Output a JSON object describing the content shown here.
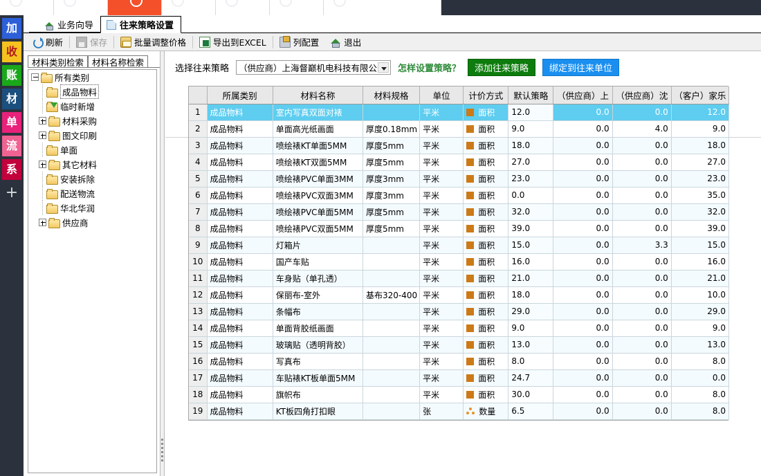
{
  "rail": {
    "items": [
      {
        "label": "加",
        "color": "#2d5fd9",
        "text": "#ffffff"
      },
      {
        "label": "收",
        "color": "#f5c21f",
        "text": "#b21b1b"
      },
      {
        "label": "账",
        "color": "#1aa81a",
        "text": "#ffffff"
      },
      {
        "label": "材",
        "color": "#1b4f7e",
        "text": "#ffffff"
      },
      {
        "label": "单",
        "color": "#e8217a",
        "text": "#ffffff"
      },
      {
        "label": "流",
        "color": "#f06292",
        "text": "#ffffff"
      },
      {
        "label": "系",
        "color": "#c2003c",
        "text": "#ffffff"
      }
    ],
    "add_label": "+"
  },
  "tabs": [
    {
      "label": "业务向导",
      "icon": "home-icon",
      "active": false
    },
    {
      "label": "往来策略设置",
      "icon": "document-icon",
      "active": true
    }
  ],
  "toolbar": {
    "refresh": "刷新",
    "save": "保存",
    "batch_price": "批量调整价格",
    "export_excel": "导出到EXCEL",
    "column_config": "列配置",
    "exit": "退出"
  },
  "left_panel": {
    "tabs": [
      {
        "label": "材料类别检索",
        "selected": true
      },
      {
        "label": "材料名称检索",
        "selected": false
      }
    ],
    "tree": [
      {
        "label": "所有类别",
        "depth": 0,
        "toggle": "minus",
        "folder": "open",
        "selected": false
      },
      {
        "label": "成品物料",
        "depth": 1,
        "toggle": "none",
        "folder": "closed",
        "selected": true
      },
      {
        "label": "临时新增",
        "depth": 1,
        "toggle": "none",
        "folder": "arrow",
        "selected": false
      },
      {
        "label": "材料采购",
        "depth": 1,
        "toggle": "plus",
        "folder": "closed",
        "selected": false
      },
      {
        "label": "图文印刷",
        "depth": 1,
        "toggle": "plus",
        "folder": "closed",
        "selected": false
      },
      {
        "label": "单面",
        "depth": 1,
        "toggle": "none",
        "folder": "closed",
        "selected": false
      },
      {
        "label": "其它材料",
        "depth": 1,
        "toggle": "plus",
        "folder": "closed",
        "selected": false
      },
      {
        "label": "安装拆除",
        "depth": 1,
        "toggle": "none",
        "folder": "closed",
        "selected": false
      },
      {
        "label": "配送物流",
        "depth": 1,
        "toggle": "none",
        "folder": "closed",
        "selected": false
      },
      {
        "label": "华北华润",
        "depth": 1,
        "toggle": "none",
        "folder": "closed",
        "selected": false
      },
      {
        "label": "供应商",
        "depth": 1,
        "toggle": "plus",
        "folder": "closed",
        "selected": false
      }
    ]
  },
  "control_bar": {
    "select_label": "选择往来策略",
    "combo_value": "（供应商）上海督巅机电科技有限公",
    "hint_link": "怎样设置策略？",
    "add_button": "添加往来策略",
    "bind_button": "绑定到往来单位",
    "add_button_color": "#0d7c0d",
    "bind_button_color": "#1a8ff0"
  },
  "grid": {
    "columns": [
      "",
      "所属类别",
      "材料名称",
      "材料规格",
      "单位",
      "计价方式",
      "默认策略",
      "（供应商）上",
      "（供应商）沈",
      "（客户）家乐"
    ],
    "rows": [
      {
        "idx": "1",
        "category": "成品物料",
        "name": "室内写真双面对裱",
        "spec": "",
        "unit": "平米",
        "price_mode": "面积",
        "mode_icon": "area-icon",
        "default": "12.0",
        "s1": "0.0",
        "s2": "0.0",
        "c1": "12.0",
        "selected": true
      },
      {
        "idx": "2",
        "category": "成品物料",
        "name": "单面高光纸画面",
        "spec": "厚度0.18mm",
        "unit": "平米",
        "price_mode": "面积",
        "mode_icon": "area-icon",
        "default": "9.0",
        "s1": "0.0",
        "s2": "4.0",
        "c1": "9.0",
        "selected": false
      },
      {
        "idx": "3",
        "category": "成品物料",
        "name": "喷绘裱KT单面5MM",
        "spec": "厚度5mm",
        "unit": "平米",
        "price_mode": "面积",
        "mode_icon": "area-icon",
        "default": "18.0",
        "s1": "0.0",
        "s2": "0.0",
        "c1": "18.0",
        "selected": false
      },
      {
        "idx": "4",
        "category": "成品物料",
        "name": "喷绘裱KT双面5MM",
        "spec": "厚度5mm",
        "unit": "平米",
        "price_mode": "面积",
        "mode_icon": "area-icon",
        "default": "27.0",
        "s1": "0.0",
        "s2": "0.0",
        "c1": "27.0",
        "selected": false
      },
      {
        "idx": "5",
        "category": "成品物料",
        "name": "喷绘裱PVC单面3MM",
        "spec": "厚度3mm",
        "unit": "平米",
        "price_mode": "面积",
        "mode_icon": "area-icon",
        "default": "23.0",
        "s1": "0.0",
        "s2": "0.0",
        "c1": "23.0",
        "selected": false
      },
      {
        "idx": "6",
        "category": "成品物料",
        "name": "喷绘裱PVC双面3MM",
        "spec": "厚度3mm",
        "unit": "平米",
        "price_mode": "面积",
        "mode_icon": "area-icon",
        "default": "0.0",
        "s1": "0.0",
        "s2": "0.0",
        "c1": "35.0",
        "selected": false
      },
      {
        "idx": "7",
        "category": "成品物料",
        "name": "喷绘裱PVC单面5MM",
        "spec": "厚度5mm",
        "unit": "平米",
        "price_mode": "面积",
        "mode_icon": "area-icon",
        "default": "32.0",
        "s1": "0.0",
        "s2": "0.0",
        "c1": "32.0",
        "selected": false
      },
      {
        "idx": "8",
        "category": "成品物料",
        "name": "喷绘裱PVC双面5MM",
        "spec": "厚度5mm",
        "unit": "平米",
        "price_mode": "面积",
        "mode_icon": "area-icon",
        "default": "39.0",
        "s1": "0.0",
        "s2": "0.0",
        "c1": "39.0",
        "selected": false
      },
      {
        "idx": "9",
        "category": "成品物料",
        "name": "灯箱片",
        "spec": "",
        "unit": "平米",
        "price_mode": "面积",
        "mode_icon": "area-icon",
        "default": "15.0",
        "s1": "0.0",
        "s2": "3.3",
        "c1": "15.0",
        "selected": false
      },
      {
        "idx": "10",
        "category": "成品物料",
        "name": "国产车贴",
        "spec": "",
        "unit": "平米",
        "price_mode": "面积",
        "mode_icon": "area-icon",
        "default": "16.0",
        "s1": "0.0",
        "s2": "0.0",
        "c1": "16.0",
        "selected": false
      },
      {
        "idx": "11",
        "category": "成品物料",
        "name": "车身贴（单孔透）",
        "spec": "",
        "unit": "平米",
        "price_mode": "面积",
        "mode_icon": "area-icon",
        "default": "21.0",
        "s1": "0.0",
        "s2": "0.0",
        "c1": "21.0",
        "selected": false
      },
      {
        "idx": "12",
        "category": "成品物料",
        "name": "保丽布-室外",
        "spec": "基布320-400",
        "unit": "平米",
        "price_mode": "面积",
        "mode_icon": "area-icon",
        "default": "18.0",
        "s1": "0.0",
        "s2": "0.0",
        "c1": "10.0",
        "selected": false
      },
      {
        "idx": "13",
        "category": "成品物料",
        "name": "条幅布",
        "spec": "",
        "unit": "平米",
        "price_mode": "面积",
        "mode_icon": "area-icon",
        "default": "29.0",
        "s1": "0.0",
        "s2": "0.0",
        "c1": "29.0",
        "selected": false
      },
      {
        "idx": "14",
        "category": "成品物料",
        "name": "单面背胶纸画面",
        "spec": "",
        "unit": "平米",
        "price_mode": "面积",
        "mode_icon": "area-icon",
        "default": "9.0",
        "s1": "0.0",
        "s2": "0.0",
        "c1": "9.0",
        "selected": false
      },
      {
        "idx": "15",
        "category": "成品物料",
        "name": "玻璃贴（透明背胶）",
        "spec": "",
        "unit": "平米",
        "price_mode": "面积",
        "mode_icon": "area-icon",
        "default": "13.0",
        "s1": "0.0",
        "s2": "0.0",
        "c1": "13.0",
        "selected": false
      },
      {
        "idx": "16",
        "category": "成品物料",
        "name": "写真布",
        "spec": "",
        "unit": "平米",
        "price_mode": "面积",
        "mode_icon": "area-icon",
        "default": "8.0",
        "s1": "0.0",
        "s2": "0.0",
        "c1": "8.0",
        "selected": false
      },
      {
        "idx": "17",
        "category": "成品物料",
        "name": "车贴裱KT板单面5MM",
        "spec": "",
        "unit": "平米",
        "price_mode": "面积",
        "mode_icon": "area-icon",
        "default": "24.7",
        "s1": "0.0",
        "s2": "0.0",
        "c1": "0.0",
        "selected": false
      },
      {
        "idx": "18",
        "category": "成品物料",
        "name": "旗帜布",
        "spec": "",
        "unit": "平米",
        "price_mode": "面积",
        "mode_icon": "area-icon",
        "default": "30.0",
        "s1": "0.0",
        "s2": "0.0",
        "c1": "8.0",
        "selected": false
      },
      {
        "idx": "19",
        "category": "成品物料",
        "name": "KT板四角打扣眼",
        "spec": "",
        "unit": "张",
        "price_mode": "数量",
        "mode_icon": "quantity-icon",
        "default": "6.5",
        "s1": "0.0",
        "s2": "0.0",
        "c1": "8.0",
        "selected": false
      }
    ]
  }
}
